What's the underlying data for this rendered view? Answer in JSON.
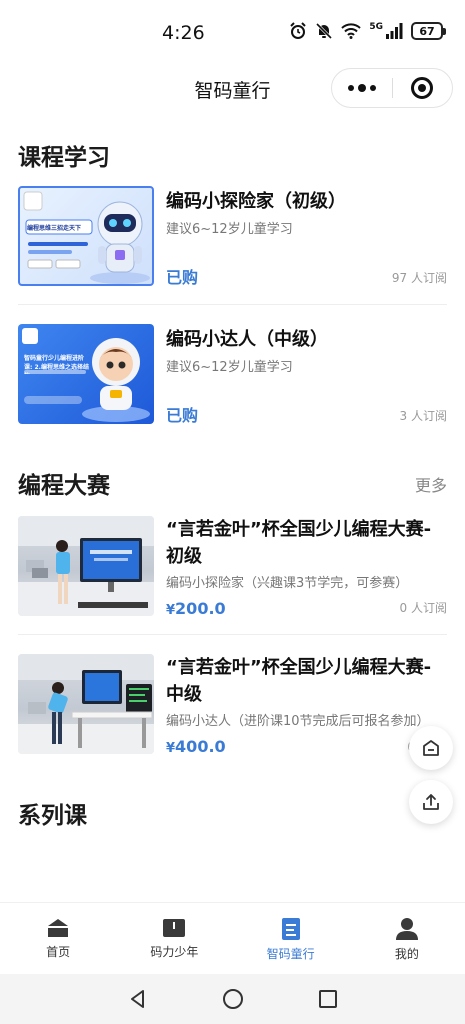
{
  "status_bar": {
    "time": "4:26",
    "network": "5G",
    "battery": "67"
  },
  "nav": {
    "title": "智码童行"
  },
  "sections": {
    "courses": {
      "title": "课程学习"
    },
    "contests": {
      "title": "编程大赛",
      "more": "更多"
    },
    "series": {
      "title": "系列课"
    }
  },
  "courses": [
    {
      "title": "编码小探险家（初级）",
      "subtitle": "建议6~12岁儿童学习",
      "status": "已购",
      "subscribers": "97 人订阅",
      "thumb_text": "编程思维三招走天下"
    },
    {
      "title": "编码小达人（中级）",
      "subtitle": "建议6~12岁儿童学习",
      "status": "已购",
      "subscribers": "3 人订阅",
      "thumb_text": "智码童行少儿编程进阶课: 2.编程思维之选择结构"
    }
  ],
  "contests": [
    {
      "title": "“言若金叶”杯全国少儿编程大赛-初级",
      "subtitle": "编码小探险家（兴趣课3节学完，可参赛）",
      "currency": "¥",
      "price": "200.0",
      "subscribers": "0 人订阅"
    },
    {
      "title": "“言若金叶”杯全国少儿编程大赛-中级",
      "subtitle": "编码小达人（进阶课10节完成后可报名参加）",
      "currency": "¥",
      "price": "400.0",
      "subscribers": "0"
    }
  ],
  "tabs": [
    {
      "label": "首页",
      "icon": "home-icon",
      "active": false
    },
    {
      "label": "码力少年",
      "icon": "book-icon",
      "active": false
    },
    {
      "label": "智码童行",
      "icon": "document-icon",
      "active": true
    },
    {
      "label": "我的",
      "icon": "user-icon",
      "active": false
    }
  ],
  "colors": {
    "accent": "#3a7bd5",
    "text": "#111111",
    "muted": "#888888"
  }
}
